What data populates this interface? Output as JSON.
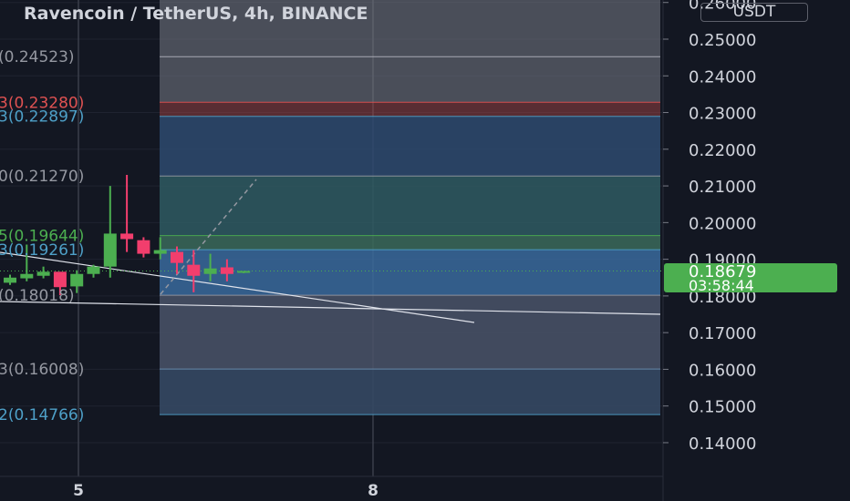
{
  "header": {
    "title": "Ravencoin / TetherUS, 4h, BINANCE",
    "currency": "USDT"
  },
  "price_axis": {
    "ticks": [
      "0.26000",
      "0.25000",
      "0.24000",
      "0.23000",
      "0.22000",
      "0.21000",
      "0.20000",
      "0.19000",
      "0.18000",
      "0.17000",
      "0.16000",
      "0.15000",
      "0.14000"
    ],
    "last_price": "0.18679",
    "countdown": "03:58:44"
  },
  "time_axis": {
    "ticks": [
      "5",
      "8"
    ]
  },
  "fib_labels": [
    {
      "text": "(0.24523)",
      "price": 0.24523,
      "color": "#9598a1"
    },
    {
      "text": "3(0.23280)",
      "price": 0.2328,
      "color": "#e05252"
    },
    {
      "text": "3(0.22897)",
      "price": 0.22897,
      "color": "#4ea0c8"
    },
    {
      "text": "0(0.21270)",
      "price": 0.2127,
      "color": "#9598a1"
    },
    {
      "text": "5(0.19644)",
      "price": 0.19644,
      "color": "#4caf50"
    },
    {
      "text": "3(0.19261)",
      "price": 0.19261,
      "color": "#4ea0c8"
    },
    {
      "text": "(0.18018)",
      "price": 0.18018,
      "color": "#9598a1"
    },
    {
      "text": "3(0.16008)",
      "price": 0.16008,
      "color": "#9598a1"
    },
    {
      "text": "2(0.14766)",
      "price": 0.14766,
      "color": "#4ea0c8"
    }
  ],
  "colors": {
    "background": "#131722",
    "up": "#4caf50",
    "down": "#f23e6d",
    "grid": "#3a3e4a",
    "last_price_badge": "#4caf50"
  },
  "chart_data": {
    "type": "candlestick",
    "title": "Ravencoin / TetherUS, 4h, BINANCE",
    "ylim": [
      0.13,
      0.26
    ],
    "y_ticks": [
      0.26,
      0.25,
      0.24,
      0.23,
      0.22,
      0.21,
      0.2,
      0.19,
      0.18,
      0.17,
      0.16,
      0.15,
      0.14
    ],
    "candles": [
      {
        "open": 0.1836,
        "high": 0.1858,
        "low": 0.183,
        "close": 0.185
      },
      {
        "open": 0.1848,
        "high": 0.194,
        "low": 0.184,
        "close": 0.186
      },
      {
        "open": 0.1855,
        "high": 0.188,
        "low": 0.1848,
        "close": 0.1866
      },
      {
        "open": 0.1866,
        "high": 0.1864,
        "low": 0.1802,
        "close": 0.1824
      },
      {
        "open": 0.1826,
        "high": 0.187,
        "low": 0.1808,
        "close": 0.186
      },
      {
        "open": 0.186,
        "high": 0.1885,
        "low": 0.185,
        "close": 0.188
      },
      {
        "open": 0.188,
        "high": 0.21,
        "low": 0.185,
        "close": 0.197
      },
      {
        "open": 0.197,
        "high": 0.213,
        "low": 0.192,
        "close": 0.1955
      },
      {
        "open": 0.1952,
        "high": 0.196,
        "low": 0.1905,
        "close": 0.1915
      },
      {
        "open": 0.1915,
        "high": 0.196,
        "low": 0.19,
        "close": 0.1925
      },
      {
        "open": 0.192,
        "high": 0.1935,
        "low": 0.186,
        "close": 0.189
      },
      {
        "open": 0.1885,
        "high": 0.1925,
        "low": 0.181,
        "close": 0.1855
      },
      {
        "open": 0.186,
        "high": 0.1915,
        "low": 0.184,
        "close": 0.1875
      },
      {
        "open": 0.1878,
        "high": 0.19,
        "low": 0.184,
        "close": 0.186
      },
      {
        "open": 0.1866,
        "high": 0.1868,
        "low": 0.1862,
        "close": 0.1868
      }
    ],
    "last_price": 0.18679,
    "fib_levels": [
      0.24523,
      0.2328,
      0.22897,
      0.2127,
      0.19644,
      0.19261,
      0.18018,
      0.16008,
      0.14766
    ]
  }
}
